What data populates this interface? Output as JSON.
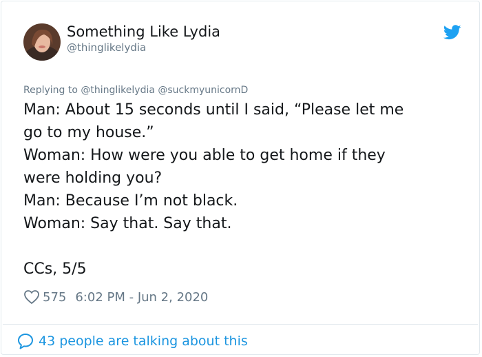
{
  "author": {
    "display_name": "Something Like Lydia",
    "handle": "@thinglikelydia",
    "avatar_icon": "user-avatar"
  },
  "brand": {
    "icon": "twitter-bird-icon",
    "color": "#1da1f2"
  },
  "reply_context": "Replying to @thinglikelydia @suckmyunicornD",
  "tweet": {
    "lines": [
      "Man: About 15 seconds until I said, “Please let me",
      "go to my house.”",
      "Woman: How were you able to get home if they",
      "were holding you?",
      "Man: Because I’m not black.",
      "Woman: Say that. Say that.",
      "CCs, 5/5"
    ]
  },
  "meta": {
    "like_count": "575",
    "timestamp": "6:02 PM - Jun 2, 2020"
  },
  "conversation": {
    "label": "43 people are talking about this",
    "color": "#1b95e0"
  }
}
